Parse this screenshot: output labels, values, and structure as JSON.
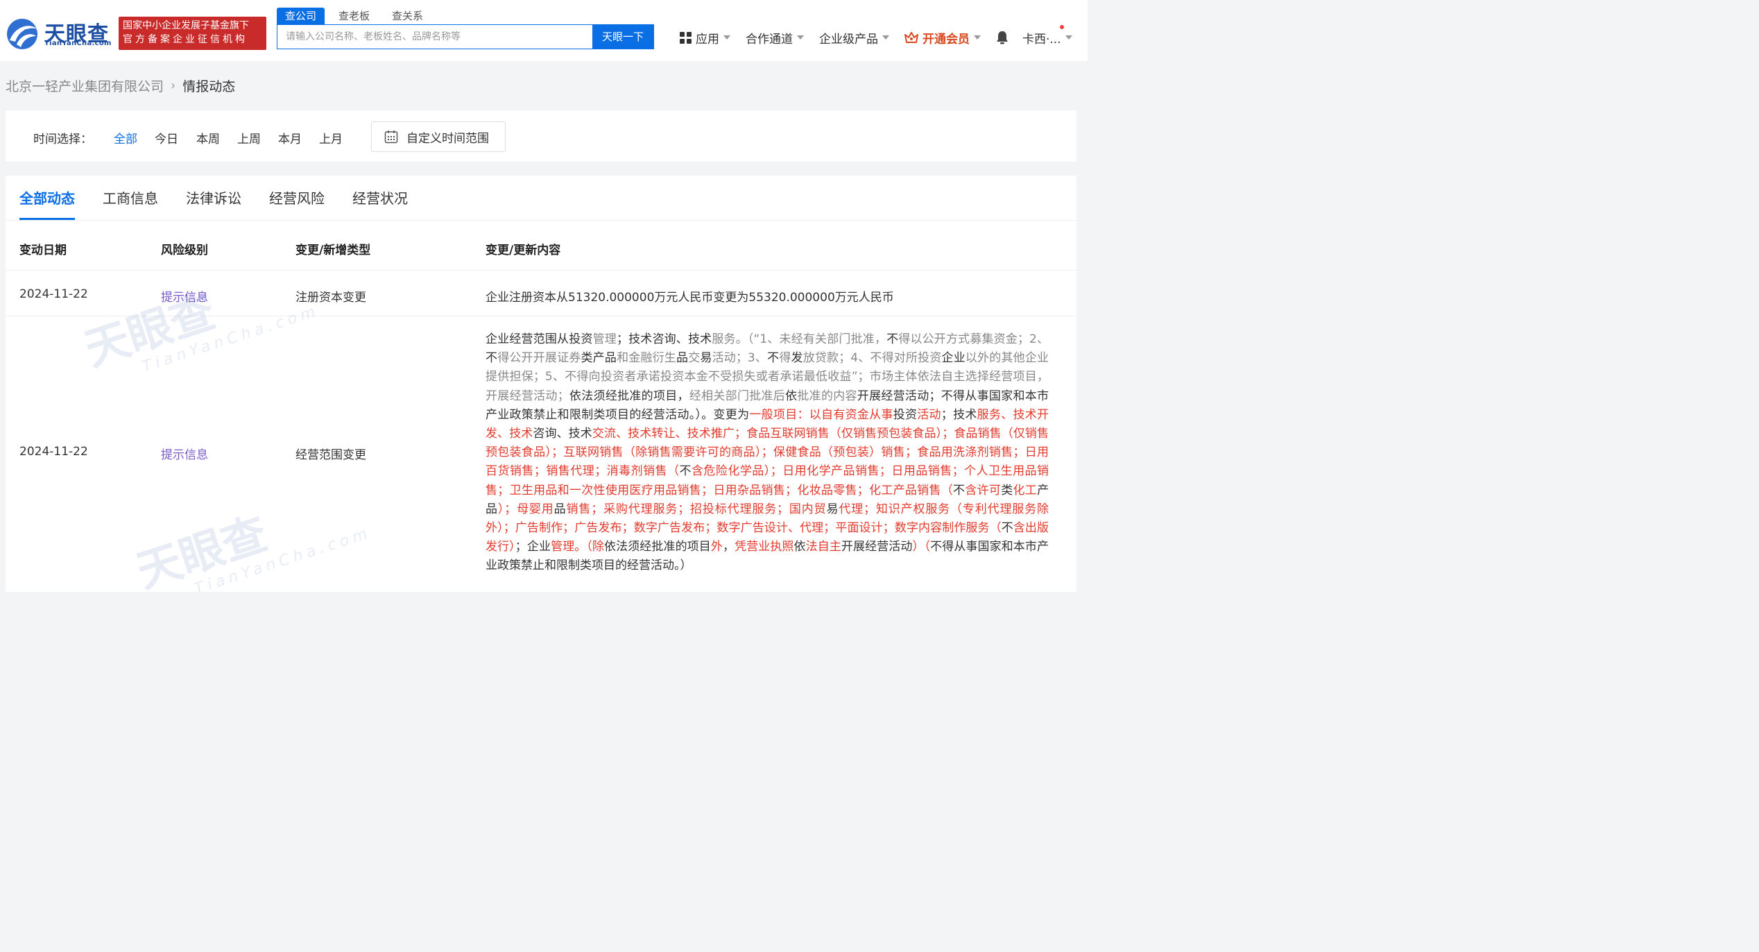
{
  "header": {
    "logo_text": "天眼查",
    "logo_sub": "TianYanCha.com",
    "gov_badge_line1": "国家中小企业发展子基金旗下",
    "gov_badge_line2": "官方备案企业征信机构",
    "search_tabs": [
      "查公司",
      "查老板",
      "查关系"
    ],
    "search_placeholder": "请输入公司名称、老板姓名、品牌名称等",
    "search_button": "天眼一下",
    "nav": {
      "apps": "应用",
      "partner": "合作通道",
      "enterprise": "企业级产品",
      "vip": "开通会员",
      "user": "卡西·..."
    }
  },
  "breadcrumb": {
    "company": "北京一轻产业集团有限公司",
    "current": "情报动态"
  },
  "time_filter": {
    "label": "时间选择：",
    "options": [
      "全部",
      "今日",
      "本周",
      "上周",
      "本月",
      "上月"
    ],
    "custom": "自定义时间范围"
  },
  "tabs": [
    "全部动态",
    "工商信息",
    "法律诉讼",
    "经营风险",
    "经营状况"
  ],
  "table": {
    "headers": [
      "变动日期",
      "风险级别",
      "变更/新增类型",
      "变更/更新内容"
    ],
    "rows": [
      {
        "date": "2024-11-22",
        "risk": "提示信息",
        "type": "注册资本变更",
        "content": "企业注册资本从51320.000000万元人民币变更为55320.000000万元人民币"
      },
      {
        "date": "2024-11-22",
        "risk": "提示信息",
        "type": "经营范围变更",
        "content_segments": [
          {
            "t": "企业经营范围从投资",
            "c": ""
          },
          {
            "t": "管理",
            "c": "gray"
          },
          {
            "t": "；技术咨询、技术",
            "c": ""
          },
          {
            "t": "服务。（“1、未经有关部门批准，",
            "c": "gray"
          },
          {
            "t": "不",
            "c": ""
          },
          {
            "t": "得以公开方式募集资金；2、",
            "c": "gray"
          },
          {
            "t": "不",
            "c": ""
          },
          {
            "t": "得公开开展证券",
            "c": "gray"
          },
          {
            "t": "类产品",
            "c": ""
          },
          {
            "t": "和金融衍生",
            "c": "gray"
          },
          {
            "t": "品",
            "c": ""
          },
          {
            "t": "交",
            "c": "gray"
          },
          {
            "t": "易",
            "c": ""
          },
          {
            "t": "活动；3、",
            "c": "gray"
          },
          {
            "t": "不",
            "c": ""
          },
          {
            "t": "得",
            "c": "gray"
          },
          {
            "t": "发",
            "c": ""
          },
          {
            "t": "放贷款；4、不得对所投资",
            "c": "gray"
          },
          {
            "t": "企业",
            "c": ""
          },
          {
            "t": "以外的其他企业提供担保；5、不得向投资者承诺投资本金不受损失或者承诺最低收益”；市场主体依法自主选择经营项目，开展经营活动；",
            "c": "gray"
          },
          {
            "t": "依法须经批准的项目，",
            "c": ""
          },
          {
            "t": "经相关部门批准后",
            "c": "gray"
          },
          {
            "t": "依",
            "c": ""
          },
          {
            "t": "批准的内容",
            "c": "gray"
          },
          {
            "t": "开展经营活动；不得从事国家和本市产业政策禁止和限制类项目的经营活动。）。变更为",
            "c": ""
          },
          {
            "t": "一般项目：以自有资金从事",
            "c": "red"
          },
          {
            "t": "投资",
            "c": ""
          },
          {
            "t": "活动",
            "c": "red"
          },
          {
            "t": "；技术",
            "c": ""
          },
          {
            "t": "服务、技术开发、技术",
            "c": "red"
          },
          {
            "t": "咨询、技术",
            "c": ""
          },
          {
            "t": "交流、技术转让、技术推广；食品互联网销售（仅销售预包装食品）；食品销售（仅销售预包装食品）；互联网销售（除销售需要许可的商品）；保健食品（预包装）销售；食品用洗涤剂销售；日用百货销售；销售代理；消毒剂销售（",
            "c": "red"
          },
          {
            "t": "不",
            "c": ""
          },
          {
            "t": "含危险化学品）；日用化学产品销售；日用品销售；个人卫生用品销售；卫生用品和一次性使用医疗用品销售；日用杂品销售；化妆品零售；化工产品销售（",
            "c": "red"
          },
          {
            "t": "不",
            "c": ""
          },
          {
            "t": "含许可",
            "c": "red"
          },
          {
            "t": "类",
            "c": ""
          },
          {
            "t": "化工",
            "c": "red"
          },
          {
            "t": "产品",
            "c": ""
          },
          {
            "t": "）；母婴用",
            "c": "red"
          },
          {
            "t": "品",
            "c": ""
          },
          {
            "t": "销售；采购代理服务；招投标代理服务；国内贸",
            "c": "red"
          },
          {
            "t": "易",
            "c": ""
          },
          {
            "t": "代理；知识产权服务（专利代理服务除外）；广告制作；广告发布；数字广告发布；数字广告设计、代理；平面设计；数字内容制作服务（",
            "c": "red"
          },
          {
            "t": "不",
            "c": ""
          },
          {
            "t": "含出版发行）",
            "c": "red"
          },
          {
            "t": "；企业",
            "c": ""
          },
          {
            "t": "管理。（除",
            "c": "red"
          },
          {
            "t": "依法须经批准的项目",
            "c": ""
          },
          {
            "t": "外",
            "c": "red"
          },
          {
            "t": "，",
            "c": ""
          },
          {
            "t": "凭营业执照",
            "c": "red"
          },
          {
            "t": "依",
            "c": ""
          },
          {
            "t": "法自主",
            "c": "red"
          },
          {
            "t": "开展经营活动",
            "c": ""
          },
          {
            "t": "）（",
            "c": "red"
          },
          {
            "t": "不得从事国家和本市产业政策禁止和限制类项目的经营活动。）",
            "c": ""
          }
        ]
      }
    ]
  },
  "watermark": {
    "text": "天眼查",
    "sub": "TianYanCha.com"
  },
  "colors": {
    "primary": "#0a6fe5",
    "badge_red": "#c92a2a",
    "vip_orange": "#d9481e",
    "risk_purple": "#7a5ac8",
    "change_red": "#e33b2e"
  }
}
